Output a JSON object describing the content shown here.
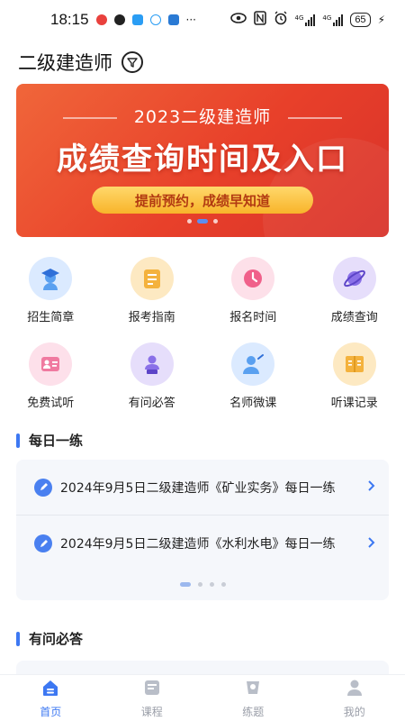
{
  "status_bar": {
    "time": "18:15",
    "notification_icons": [
      "weibo-icon",
      "qq-icon",
      "shield-icon",
      "chat-icon",
      "app-icon"
    ],
    "more": "···",
    "network": "4G",
    "network2": "4G",
    "battery": "65"
  },
  "header": {
    "title": "二级建造师",
    "filter_icon": "filter-icon"
  },
  "banner": {
    "year_title": "2023二级建造师",
    "main_text": "成绩查询时间及入口",
    "pill_text": "提前预约，成绩早知道",
    "slides": 3,
    "active_slide": 2
  },
  "grid": {
    "items": [
      {
        "label": "招生简章",
        "icon": "graduate-icon",
        "color": "#5aa0f0"
      },
      {
        "label": "报考指南",
        "icon": "book-icon",
        "color": "#f4b23d"
      },
      {
        "label": "报名时间",
        "icon": "clock-icon",
        "color": "#f0608a"
      },
      {
        "label": "成绩查询",
        "icon": "planet-icon",
        "color": "#8a70e8"
      },
      {
        "label": "免费试听",
        "icon": "contact-card-icon",
        "color": "#f07aa0"
      },
      {
        "label": "有问必答",
        "icon": "speaker-icon",
        "color": "#8a70e8"
      },
      {
        "label": "名师微课",
        "icon": "teacher-icon",
        "color": "#5aa0f0"
      },
      {
        "label": "听课记录",
        "icon": "notebook-icon",
        "color": "#f4b23d"
      }
    ]
  },
  "daily_practice": {
    "title": "每日一练",
    "items": [
      {
        "text": "2024年9月5日二级建造师《矿业实务》每日一练"
      },
      {
        "text": "2024年9月5日二级建造师《水利水电》每日一练"
      }
    ],
    "pages": 4,
    "active_page": 1
  },
  "qa_section": {
    "title": "有问必答"
  },
  "tabbar": {
    "tabs": [
      {
        "label": "首页",
        "icon": "home-icon",
        "active": true
      },
      {
        "label": "课程",
        "icon": "course-icon",
        "active": false
      },
      {
        "label": "练题",
        "icon": "practice-icon",
        "active": false
      },
      {
        "label": "我的",
        "icon": "profile-icon",
        "active": false
      }
    ]
  },
  "colors": {
    "accent": "#3d78f2",
    "banner_red": "#e8402a",
    "pill_yellow": "#f8b42a"
  }
}
